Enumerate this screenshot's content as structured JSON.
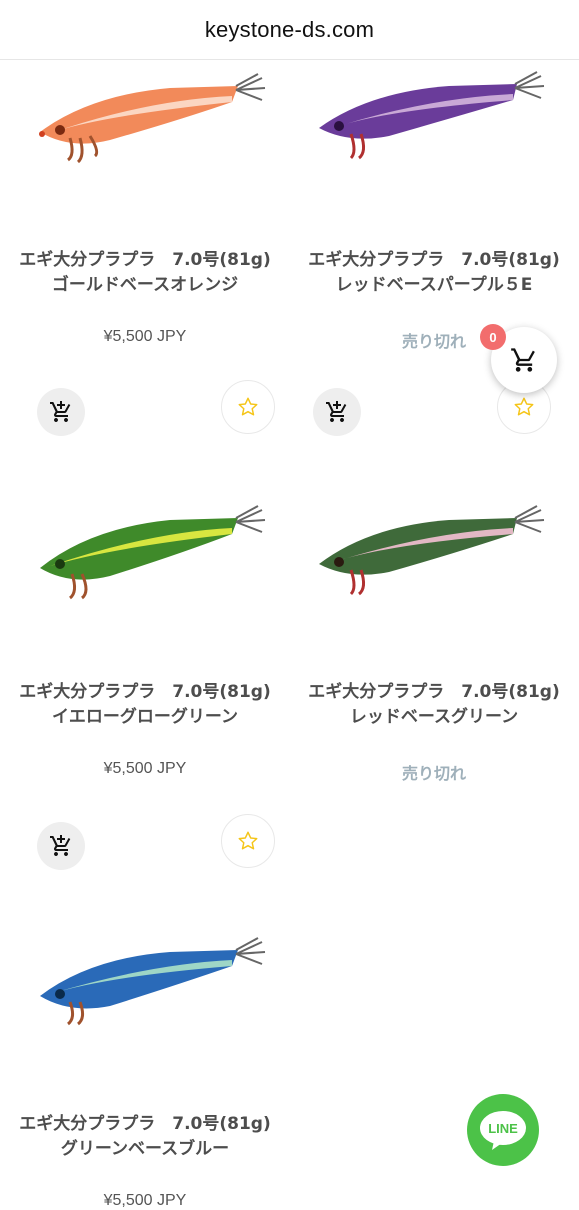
{
  "header": {
    "domain": "keystone-ds.com"
  },
  "products": [
    {
      "name": "エギ大分プラプラ　7.0号(81g)　ゴールドベースオレンジ",
      "price": "¥5,500 JPY",
      "soldout": ""
    },
    {
      "name": "エギ大分プラプラ　7.0号(81g)　レッドベースパープル５E",
      "price": "",
      "soldout": "売り切れ"
    },
    {
      "name": "エギ大分プラプラ　7.0号(81g)　イエローグローグリーン",
      "price": "¥5,500 JPY",
      "soldout": ""
    },
    {
      "name": "エギ大分プラプラ　7.0号(81g)　レッドベースグリーン",
      "price": "",
      "soldout": "売り切れ"
    },
    {
      "name": "エギ大分プラプラ　7.0号(81g)　グリーンベースブルー",
      "price": "¥5,500 JPY",
      "soldout": ""
    }
  ],
  "cart": {
    "count": "0"
  },
  "line": {
    "label": "LINE"
  },
  "colors": {
    "line_green": "#4cc248",
    "badge_red": "#f26d6d",
    "soldout": "#9fb0ba",
    "star": "#f5c518"
  },
  "icons": {
    "cart": "cart-icon",
    "add_to_cart": "cart-plus-icon",
    "favorite": "star-icon"
  }
}
